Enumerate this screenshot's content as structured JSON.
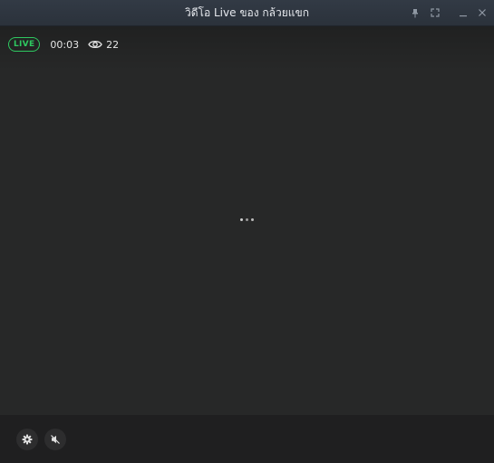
{
  "window": {
    "title": "วิดีโอ Live ของ กล้วยแขก",
    "controls": [
      {
        "name": "pin-icon"
      },
      {
        "name": "fullscreen-icon"
      },
      {
        "name": "minimize-icon"
      },
      {
        "name": "close-icon"
      }
    ]
  },
  "stream": {
    "live_label": "LIVE",
    "elapsed": "00:03",
    "viewer_count": "22",
    "loading_state": "loading-dots"
  },
  "controls": {
    "settings_icon": "gear-icon",
    "mute_icon": "speaker-muted-icon"
  },
  "colors": {
    "live_green": "#2ec860",
    "titlebar": "#2e3640",
    "background": "#272828"
  }
}
